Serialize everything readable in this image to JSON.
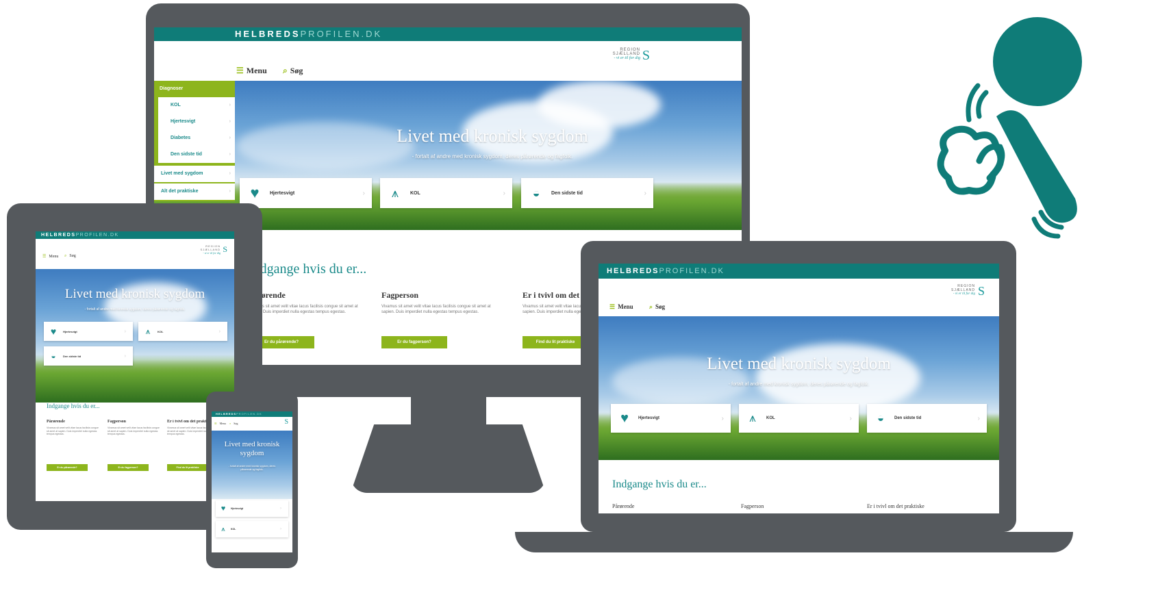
{
  "brand": {
    "part1": "HELBREDS",
    "part2": "PROFILEN.DK"
  },
  "nav": {
    "menu_label": "Menu",
    "search_label": "Søg"
  },
  "logo": {
    "line1": "REGION",
    "line2": "SJÆLLAND",
    "line3": "- vi er til for dig"
  },
  "sidebar": {
    "items": [
      {
        "label": "Diagnoser"
      },
      {
        "label": "KOL"
      },
      {
        "label": "Hjertesvigt"
      },
      {
        "label": "Diabetes"
      },
      {
        "label": "Den sidste tid"
      },
      {
        "label": "Livet med sygdom"
      },
      {
        "label": "Alt det praktiske"
      }
    ]
  },
  "hero": {
    "title": "Livet med kronisk sygdom",
    "subtitle": "- fortalt af andre med kronisk sygdom, deres pårørende og fagfolk."
  },
  "cards": [
    {
      "label": "Hjertesvigt",
      "icon": "heart-icon"
    },
    {
      "label": "KOL",
      "icon": "lungs-icon"
    },
    {
      "label": "Den sidste tid",
      "icon": "sunset-icon"
    }
  ],
  "entrances": {
    "title": "Indgange hvis du er...",
    "columns": [
      {
        "title": "Pårørende",
        "text": "Vivamus sit amet velit vitae lacus facilisis congue sit amet at sapien. Duis imperdiet nulla egestas tempus egestas.",
        "button": "Er du pårørende?"
      },
      {
        "title": "Fagperson",
        "text": "Vivamus sit amet velit vitae lacus facilisis congue sit amet at sapien. Duis imperdiet nulla egestas tempus egestas.",
        "button": "Er du fagperson?"
      },
      {
        "title": "Er i tvivl om det praktiske",
        "text": "Vivamus sit amet velit vitae lacus facilisis congue sit amet at sapien. Duis imperdiet nulla egestas tempus egestas.",
        "button": "Find du lit praktiske"
      }
    ]
  },
  "colors": {
    "teal": "#0f7c78",
    "lime": "#8db51c",
    "device": "#55595d"
  },
  "illustration": {
    "icon": "cleaning-person-icon"
  }
}
